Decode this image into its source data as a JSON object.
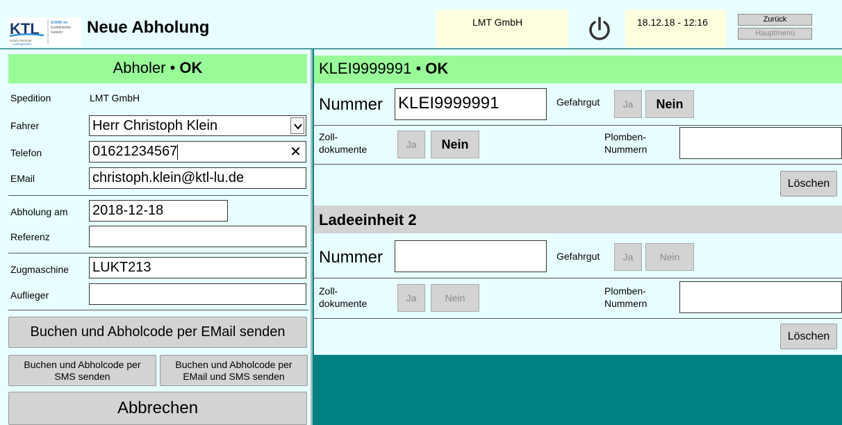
{
  "header": {
    "logo_text": "KTL",
    "logo_subtext": "STARK im Kombinierten Verkehr",
    "logo_caption": "Kombi-Terminal Ludwigshafen",
    "title": "Neue Abholung",
    "company": "LMT GmbH",
    "datetime": "18.12.18 - 12:16",
    "back_label": "Zurück",
    "main_menu_label": "Hauptmenü"
  },
  "abholer": {
    "title": "Abholer",
    "status": "OK",
    "spedition_label": "Spedition",
    "spedition_value": "LMT GmbH",
    "fahrer_label": "Fahrer",
    "fahrer_value": "Herr Christoph Klein",
    "telefon_label": "Telefon",
    "telefon_value": "01621234567",
    "email_label": "EMail",
    "email_value": "christoph.klein@ktl-lu.de",
    "abholung_label": "Abholung am",
    "abholung_value": "2018-12-18",
    "referenz_label": "Referenz",
    "referenz_value": "",
    "zugmaschine_label": "Zugmaschine",
    "zugmaschine_value": "LUKT213",
    "auflieger_label": "Auflieger",
    "auflieger_value": ""
  },
  "actions": {
    "email_button": "Buchen und Abholcode per EMail senden",
    "sms_button_line1": "Buchen und Abholcode per",
    "sms_button_line2": "SMS senden",
    "both_button_line1": "Buchen und Abholcode per",
    "both_button_line2": "EMail und SMS senden",
    "cancel_button": "Abbrechen"
  },
  "unit1": {
    "title": "KLEI9999991",
    "status": "OK",
    "nummer_label": "Nummer",
    "nummer_value": "KLEI9999991",
    "gefahrgut_label": "Gefahrgut",
    "ja_label": "Ja",
    "nein_label": "Nein",
    "zoll_label_line1": "Zoll-",
    "zoll_label_line2": "dokumente",
    "plomben_label_line1": "Plomben-",
    "plomben_label_line2": "Nummern",
    "plomben_value": "",
    "delete_button": "Löschen"
  },
  "unit2": {
    "title": "Ladeeinheit 2",
    "nummer_label": "Nummer",
    "nummer_value": "",
    "gefahrgut_label": "Gefahrgut",
    "ja_label": "Ja",
    "nein_label": "Nein",
    "zoll_label_line1": "Zoll-",
    "zoll_label_line2": "dokumente",
    "plomben_label_line1": "Plomben-",
    "plomben_label_line2": "Nummern",
    "plomben_value": "",
    "delete_button": "Löschen"
  },
  "icons": {
    "power": "power-icon",
    "dropdown": "chevron-down-icon",
    "clear": "close-icon"
  },
  "colors": {
    "ok_green": "#98fb98",
    "panel": "#e8ffff",
    "background": "#008080",
    "info_box": "#ffffe0"
  }
}
